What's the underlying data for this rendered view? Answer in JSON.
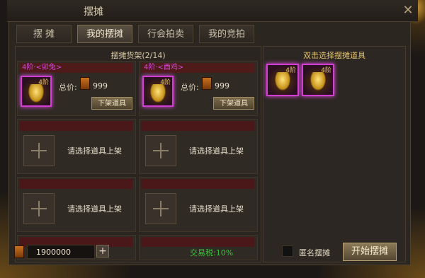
{
  "window": {
    "title": "摆摊",
    "close_symbol": "✕"
  },
  "tabs": [
    {
      "label": "摆 摊",
      "active": false
    },
    {
      "label": "我的摆摊",
      "active": true
    },
    {
      "label": "行会拍卖",
      "active": false
    },
    {
      "label": "我的竞拍",
      "active": false
    }
  ],
  "shelf": {
    "title": "摆摊货架(2/14)",
    "listed": [
      {
        "name": "4阶·<卯兔>",
        "level": "4阶",
        "price_label": "总价:",
        "price": "999",
        "delist_label": "下架道具",
        "icon": "golden-rabbit-icon"
      },
      {
        "name": "4阶·<酉鸡>",
        "level": "4阶",
        "price_label": "总价:",
        "price": "999",
        "delist_label": "下架道具",
        "icon": "golden-rooster-icon"
      }
    ],
    "empty_slot_text": "请选择道具上架",
    "empty_slots": 4
  },
  "inventory": {
    "title": "双击选择摆摊道具",
    "items": [
      {
        "level": "4阶",
        "icon": "golden-monkey-icon"
      },
      {
        "level": "4阶",
        "icon": "golden-dog-icon"
      }
    ]
  },
  "bottom": {
    "gold": "1900000",
    "add_symbol": "+",
    "tax": "交易税:10%",
    "anonymous_label": "匿名摆摊",
    "anonymous_checked": false,
    "start_label": "开始摆摊"
  },
  "colors": {
    "accent_purple": "#d23ed2",
    "tax_green": "#39c13a",
    "title_gold": "#e2c470"
  }
}
